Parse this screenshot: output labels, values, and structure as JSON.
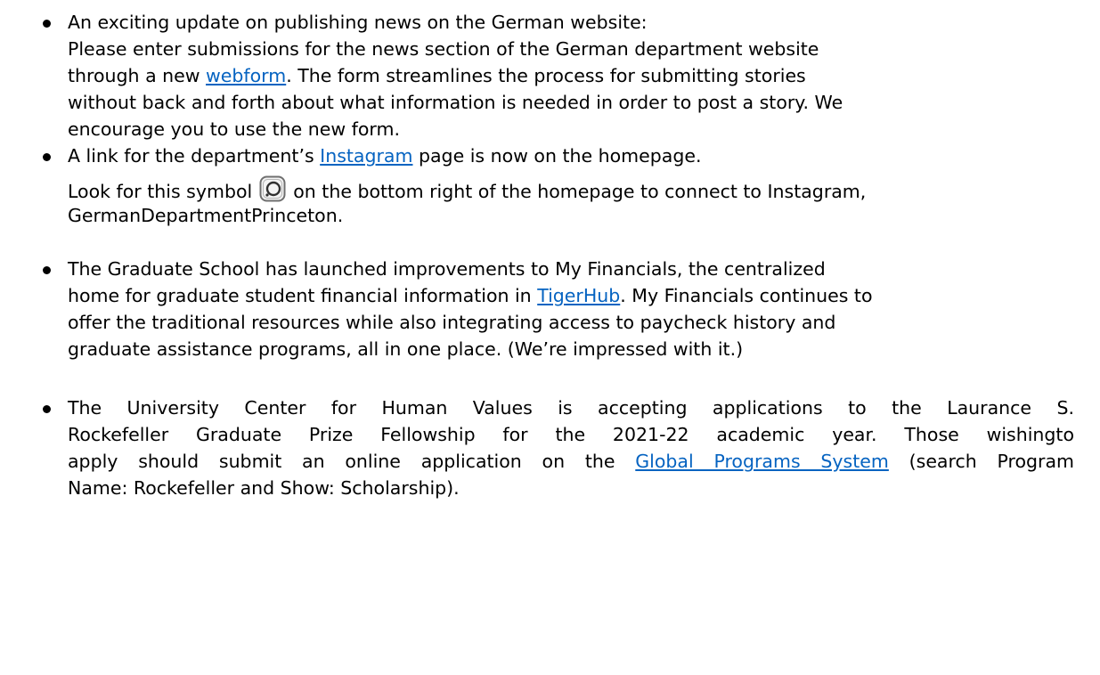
{
  "items": [
    {
      "lines": [
        "An exciting update on publishing news on the German website:",
        "Please enter submissions for the news section of the German department website",
        "through a new ",
        "webform",
        ". The form streamlines the process for submitting stories",
        "without back and forth about what information is needed in order to post a story. We",
        "encourage you to use the new form."
      ]
    },
    {
      "line1_before": "A link for the department’s ",
      "link": "Instagram",
      "line1_after": " page is now on the homepage.",
      "line2_before": "Look for this symbol ",
      "icon": "instagram-icon",
      "line2_after": " on the bottom right of the homepage to connect to Instagram,",
      "line3": "GermanDepartmentPrinceton."
    },
    {
      "line1": "The Graduate School has launched improvements to My Financials, the centralized",
      "line2_before": "home for graduate student financial information in ",
      "link": "TigerHub",
      "line2_after": ". My Financials continues to",
      "line3": "offer the traditional resources while also integrating access to paycheck history and",
      "line4": "graduate assistance programs, all in one place. (We’re impressed with it.)"
    },
    {
      "line1": "The University Center for Human Values is accepting applications to the Laurance S.",
      "line2": "Rockefeller Graduate Prize Fellowship for the 2021-22 academic year. Those wishingto",
      "line3_before": "apply should submit an online application on the ",
      "link": "Global Programs System",
      "line3_after": " (search Program",
      "line4": "Name: Rockefeller and Show: Scholarship)."
    }
  ]
}
